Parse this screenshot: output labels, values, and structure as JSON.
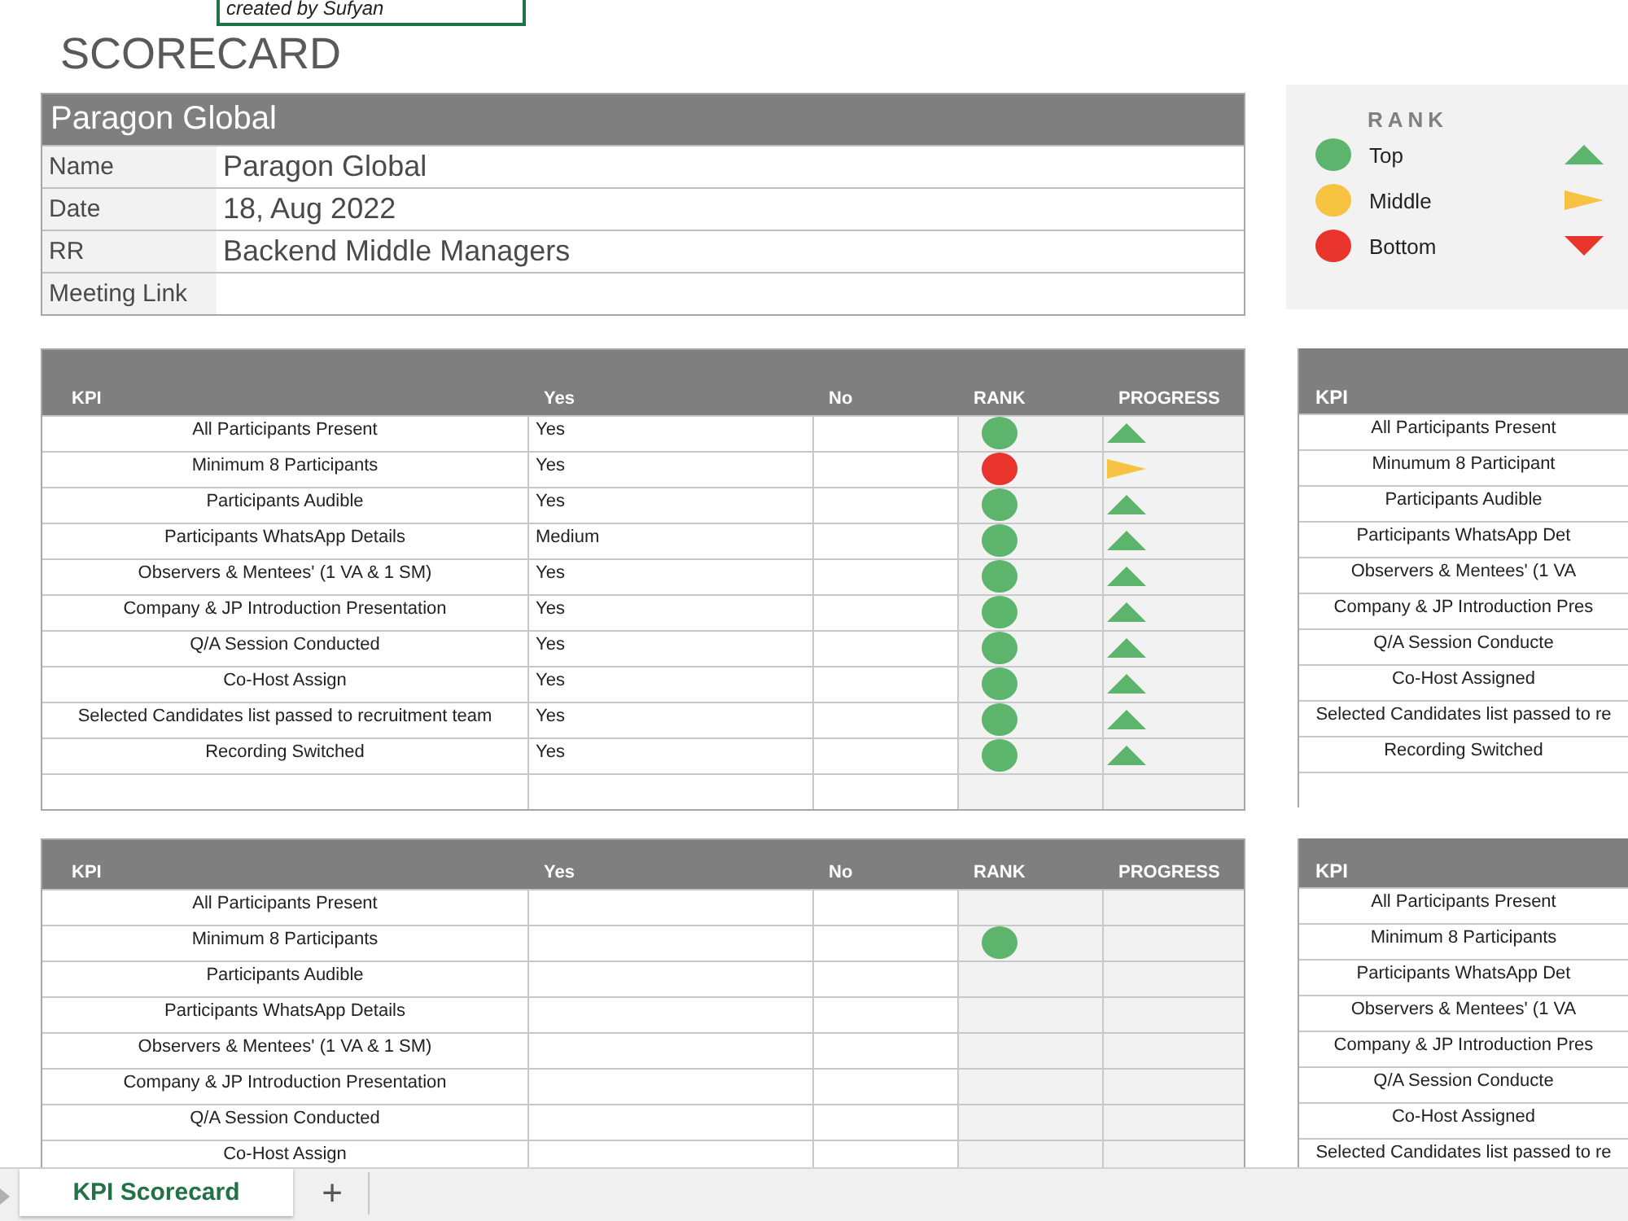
{
  "title": "SCORECARD",
  "text_box": {
    "text": "created by Sufyan"
  },
  "info_table": {
    "header": "Paragon Global",
    "rows": [
      {
        "label": "Name",
        "value": "Paragon Global"
      },
      {
        "label": "Date",
        "value": "18, Aug 2022"
      },
      {
        "label": "RR",
        "value": "Backend Middle Managers"
      },
      {
        "label": "Meeting Link"
      }
    ]
  },
  "legend": {
    "title": "RANK",
    "items": [
      {
        "label": "Top",
        "color": "#5db56d",
        "arrow": {
          "kind": "up",
          "color": "#5db56d"
        }
      },
      {
        "label": "Middle",
        "color": "#f7c142",
        "arrow": {
          "kind": "right",
          "color": "#f7c142"
        }
      },
      {
        "label": "Bottom",
        "color": "#e8342a",
        "arrow": {
          "kind": "down",
          "color": "#e8342a"
        }
      }
    ]
  },
  "kpi_tables": [
    {
      "columns": [
        "KPI",
        "Yes",
        "No",
        "RANK",
        "PROGRESS"
      ],
      "rows": [
        {
          "kpi": "All Participants Present",
          "yes": "Yes",
          "rank": {
            "color": "#5db56d"
          },
          "progress": {
            "kind": "up",
            "color": "#5db56d"
          }
        },
        {
          "kpi": "Minimum 8 Participants",
          "yes": "Yes",
          "rank": {
            "color": "#e8342a"
          },
          "progress": {
            "kind": "right",
            "color": "#f7c142"
          }
        },
        {
          "kpi": "Participants Audible",
          "yes": "Yes",
          "rank": {
            "color": "#5db56d"
          },
          "progress": {
            "kind": "up",
            "color": "#5db56d"
          }
        },
        {
          "kpi": "Participants WhatsApp Details",
          "yes": "Medium",
          "rank": {
            "color": "#5db56d"
          },
          "progress": {
            "kind": "up",
            "color": "#5db56d"
          }
        },
        {
          "kpi": "Observers & Mentees'  (1 VA & 1 SM)",
          "yes": "Yes",
          "rank": {
            "color": "#5db56d"
          },
          "progress": {
            "kind": "up",
            "color": "#5db56d"
          }
        },
        {
          "kpi": "Company & JP Introduction Presentation",
          "yes": "Yes",
          "rank": {
            "color": "#5db56d"
          },
          "progress": {
            "kind": "up",
            "color": "#5db56d"
          }
        },
        {
          "kpi": "Q/A Session Conducted",
          "yes": "Yes",
          "rank": {
            "color": "#5db56d"
          },
          "progress": {
            "kind": "up",
            "color": "#5db56d"
          }
        },
        {
          "kpi": "Co-Host Assign",
          "yes": "Yes",
          "rank": {
            "color": "#5db56d"
          },
          "progress": {
            "kind": "up",
            "color": "#5db56d"
          }
        },
        {
          "kpi": "Selected Candidates list passed to recruitment team",
          "yes": "Yes",
          "rank": {
            "color": "#5db56d"
          },
          "progress": {
            "kind": "up",
            "color": "#5db56d"
          }
        },
        {
          "kpi": "Recording Switched",
          "yes": "Yes",
          "rank": {
            "color": "#5db56d"
          },
          "progress": {
            "kind": "up",
            "color": "#5db56d"
          }
        }
      ]
    },
    {
      "columns": [
        "KPI",
        "Yes",
        "No",
        "RANK",
        "PROGRESS"
      ],
      "rows": [
        {
          "kpi": "All Participants Present"
        },
        {
          "kpi": "Minimum 8 Participants",
          "rank": {
            "color": "#5db56d"
          }
        },
        {
          "kpi": "Participants Audible"
        },
        {
          "kpi": "Participants WhatsApp Details"
        },
        {
          "kpi": "Observers & Mentees'  (1 VA & 1 SM)"
        },
        {
          "kpi": "Company & JP Introduction Presentation"
        },
        {
          "kpi": "Q/A Session Conducted"
        },
        {
          "kpi": "Co-Host Assign"
        }
      ]
    }
  ],
  "side_tables": [
    {
      "column": "KPI",
      "rows": [
        "All Participants Present",
        "Minumum 8 Participant",
        "Participants Audible",
        "Participants WhatsApp Det",
        "Observers & Mentees' (1 VA",
        "Company & JP Introduction Pres",
        "Q/A Session Conducte",
        "Co-Host Assigned",
        "Selected Candidates list passed to re",
        "Recording Switched"
      ]
    },
    {
      "column": "KPI",
      "rows": [
        "All Participants Present",
        "Minimum 8 Participants",
        "Participants WhatsApp Det",
        "Observers & Mentees' (1 VA",
        "Company & JP Introduction Pres",
        "Q/A Session Conducte",
        "Co-Host Assigned",
        "Selected Candidates list passed to re"
      ]
    }
  ],
  "sheet_tabs": [
    {
      "label": "KPI Scorecard",
      "selected": true
    }
  ],
  "add_sheet": "+"
}
